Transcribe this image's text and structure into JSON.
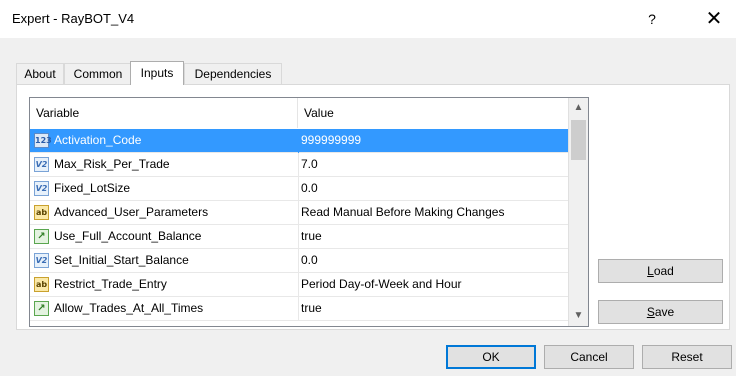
{
  "window": {
    "title": "Expert - RayBOT_V4",
    "help_label": "?",
    "close_label": "✕"
  },
  "tabs": [
    {
      "label": "About"
    },
    {
      "label": "Common"
    },
    {
      "label": "Inputs"
    },
    {
      "label": "Dependencies"
    }
  ],
  "active_tab": "Inputs",
  "grid": {
    "columns": {
      "variable": "Variable",
      "value": "Value"
    },
    "rows": [
      {
        "type": "int",
        "icon_text": "123",
        "name": "Activation_Code",
        "value": "999999999"
      },
      {
        "type": "double",
        "icon_text": "V2",
        "name": "Max_Risk_Per_Trade",
        "value": "7.0"
      },
      {
        "type": "double",
        "icon_text": "V2",
        "name": "Fixed_LotSize",
        "value": "0.0"
      },
      {
        "type": "string",
        "icon_text": "ab",
        "name": "Advanced_User_Parameters",
        "value": "Read Manual Before Making Changes"
      },
      {
        "type": "bool",
        "icon_text": "↗",
        "name": "Use_Full_Account_Balance",
        "value": "true"
      },
      {
        "type": "double",
        "icon_text": "V2",
        "name": "Set_Initial_Start_Balance",
        "value": "0.0"
      },
      {
        "type": "string",
        "icon_text": "ab",
        "name": "Restrict_Trade_Entry",
        "value": "Period Day-of-Week and Hour"
      },
      {
        "type": "bool",
        "icon_text": "↗",
        "name": "Allow_Trades_At_All_Times",
        "value": "true"
      }
    ],
    "selected_row": 0
  },
  "side_buttons": {
    "load_prefix": "",
    "load_accel": "L",
    "load_rest": "oad",
    "save_prefix": "",
    "save_accel": "S",
    "save_rest": "ave"
  },
  "footer": {
    "ok_label": "OK",
    "cancel_label": "Cancel",
    "reset_label": "Reset"
  },
  "colors": {
    "selection": "#3399ff",
    "default_button_border": "#0078d7"
  }
}
